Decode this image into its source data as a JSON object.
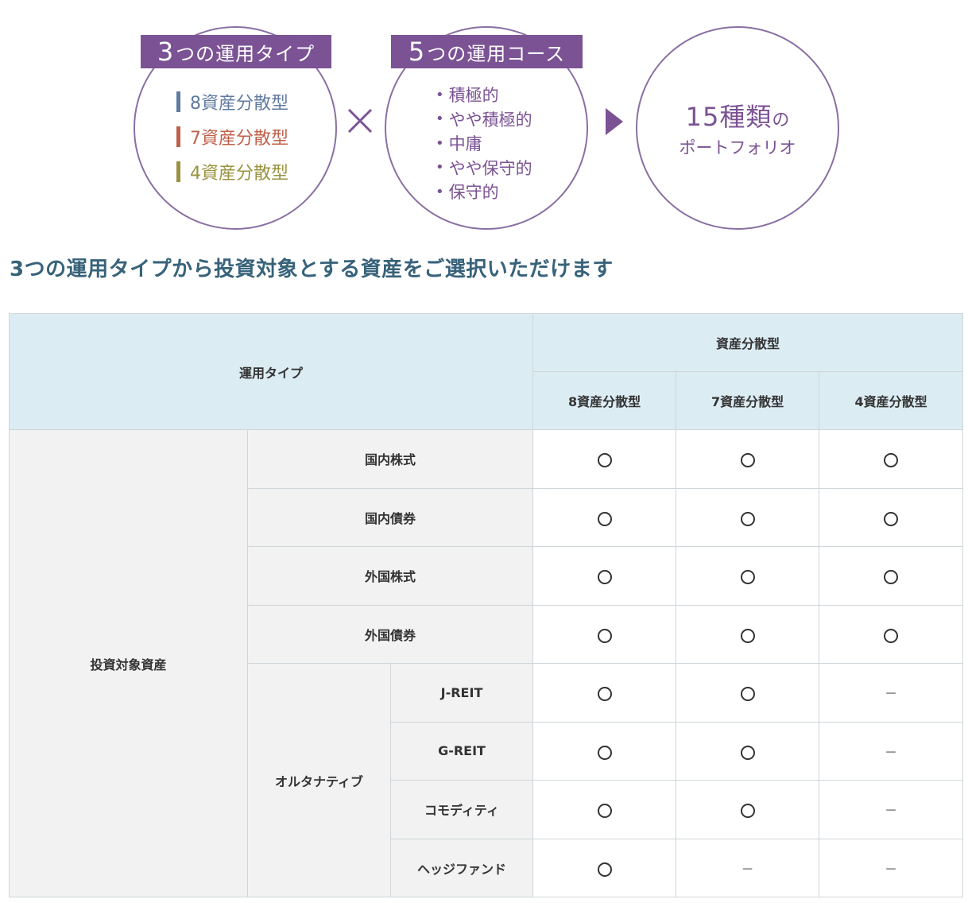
{
  "diagram": {
    "types_box": {
      "num": "3",
      "label": "つの運用タイプ"
    },
    "courses_box": {
      "num": "5",
      "label": "つの運用コース"
    },
    "types": [
      {
        "label": "8資産分散型",
        "color": "#607aa0"
      },
      {
        "label": "7資産分散型",
        "color": "#c0604a"
      },
      {
        "label": "4資産分散型",
        "color": "#9a923e"
      }
    ],
    "courses": [
      "積極的",
      "やや積極的",
      "中庸",
      "やや保守的",
      "保守的"
    ],
    "result": {
      "num": "15種類",
      "suffix": "の",
      "sub": "ポートフォリオ"
    },
    "accent_color": "#7b5294"
  },
  "heading": "3つの運用タイプから投資対象とする資産をご選択いただけます",
  "table": {
    "header": {
      "type_label": "運用タイプ",
      "group_label": "資産分散型",
      "cols": [
        "8資産分散型",
        "7資産分散型",
        "4資産分散型"
      ]
    },
    "category_label": "投資対象資産",
    "alt_label": "オルタナティブ",
    "rows": [
      {
        "label": "国内株式",
        "values": [
          "○",
          "○",
          "○"
        ]
      },
      {
        "label": "国内債券",
        "values": [
          "○",
          "○",
          "○"
        ]
      },
      {
        "label": "外国株式",
        "values": [
          "○",
          "○",
          "○"
        ]
      },
      {
        "label": "外国債券",
        "values": [
          "○",
          "○",
          "○"
        ]
      },
      {
        "label": "J-REIT",
        "values": [
          "○",
          "○",
          "－"
        ]
      },
      {
        "label": "G-REIT",
        "values": [
          "○",
          "○",
          "－"
        ]
      },
      {
        "label": "コモディティ",
        "values": [
          "○",
          "○",
          "－"
        ]
      },
      {
        "label": "ヘッジファンド",
        "values": [
          "○",
          "－",
          "－"
        ]
      }
    ]
  }
}
